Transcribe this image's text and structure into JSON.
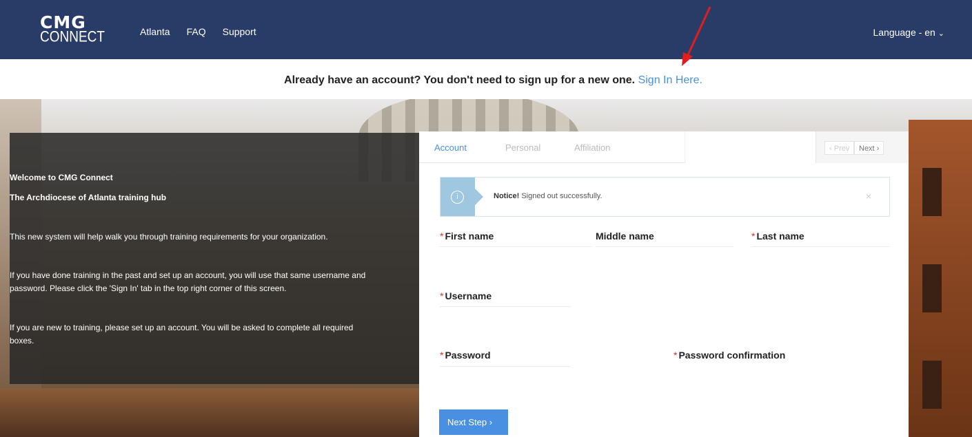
{
  "header": {
    "logo_top": "CMG",
    "logo_bottom": "CONNECT",
    "nav": [
      "Atlanta",
      "FAQ",
      "Support"
    ],
    "language": "Language - en"
  },
  "signup": {
    "text": "Already have an account? You don't need to sign up for a new one.",
    "link": "Sign In Here."
  },
  "info": {
    "welcome": "Welcome to CMG Connect",
    "subtitle": "The Archdiocese of Atlanta training hub",
    "p1": "This new system will help walk you through training requirements for your organization.",
    "p2a": "If you have done training in the past and set up an account, you will use that same username and",
    "p2b": "password.  Please click the 'Sign In' tab in the top right corner of this screen.",
    "p3a": "If you are new to training, please set up an account.  You will be asked to complete all required",
    "p3b": "boxes."
  },
  "form": {
    "tabs": [
      "Account",
      "Personal",
      "Affiliation"
    ],
    "prev": "Prev",
    "next": "Next",
    "notice_title": "Notice!",
    "notice_text": "Signed out successfully.",
    "notice_close": "×",
    "labels": {
      "first_name": "First name",
      "middle_name": "Middle name",
      "last_name": "Last name",
      "username": "Username",
      "password": "Password",
      "password_confirmation": "Password confirmation"
    },
    "required_mark": "*",
    "next_step": "Next Step ›"
  },
  "colors": {
    "navbar": "#293c68",
    "accent": "#4a90e2",
    "required": "#e0322b",
    "annotation_arrow": "#e11d1d"
  }
}
